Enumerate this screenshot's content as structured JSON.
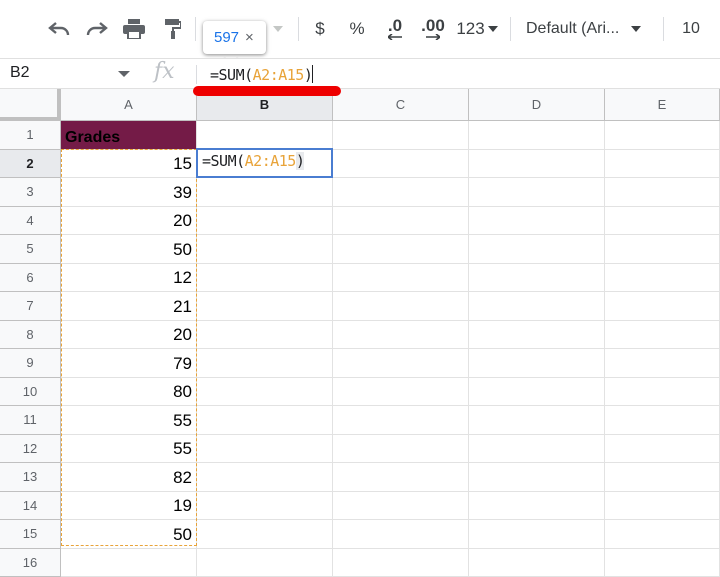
{
  "toolbar": {
    "undo_icon": "undo-icon",
    "redo_icon": "redo-icon",
    "print_icon": "print-icon",
    "paint_format_icon": "paint-format-icon",
    "currency": "$",
    "percent": "%",
    "decrease_decimal": ".0",
    "increase_decimal": ".00",
    "more_formats": "123",
    "font": "Default (Ari...",
    "font_size": "10"
  },
  "sum_tooltip": {
    "value": "597",
    "close": "×"
  },
  "formula_bar": {
    "cell_ref": "B2",
    "fx": "fx",
    "formula_prefix": "=SUM(",
    "formula_range": "A2:A15",
    "formula_suffix": ")"
  },
  "columns": [
    "A",
    "B",
    "C",
    "D",
    "E"
  ],
  "rows": [
    "1",
    "2",
    "3",
    "4",
    "5",
    "6",
    "7",
    "8",
    "9",
    "10",
    "11",
    "12",
    "13",
    "14",
    "15",
    "16"
  ],
  "header_cell": {
    "text": "Grades",
    "fill": "#741b47"
  },
  "grades": [
    "15",
    "39",
    "20",
    "50",
    "12",
    "21",
    "20",
    "79",
    "80",
    "55",
    "55",
    "82",
    "19",
    "50"
  ],
  "editing_cell": {
    "prefix": "=SUM(",
    "range": "A2:A15",
    "suffix": ")"
  },
  "colors": {
    "range_highlight": "#e8a339",
    "active_border": "#4a7dd1",
    "annotation": "#ee0000"
  }
}
